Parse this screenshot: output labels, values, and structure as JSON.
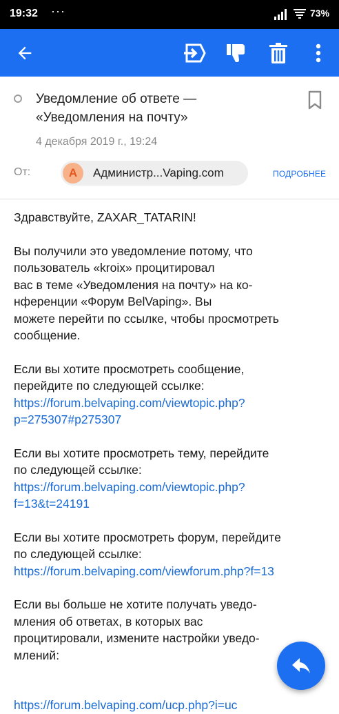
{
  "status_bar": {
    "time": "19:32",
    "dots": "···",
    "battery": "73%"
  },
  "app_bar": {
    "accent": "#1b6ff0",
    "icons": [
      "back-arrow-icon",
      "move-to-folder-icon",
      "spam-icon",
      "trash-icon",
      "more-vert-icon"
    ]
  },
  "message": {
    "subject_line1": "Уведомление об ответе —",
    "subject_line2": "«Уведомления на почту»",
    "date": "4 декабря 2019 г., 19:24",
    "from_label": "От:",
    "sender_initial": "A",
    "sender_name": "Администр...Vaping.com",
    "details_label": "ПОДРОБНЕЕ"
  },
  "body": {
    "greeting": "Здравствуйте, ZAXAR_TATARIN!",
    "p1_l1": "Вы получили это уведомление потому, что",
    "p1_l2": "пользователь «kroix» процитировал",
    "p1_l3": "вас в теме «Уведомления на почту» на ко-",
    "p1_l4": "нференции «Форум BelVaping». Вы",
    "p1_l5": "можете перейти по ссылке, чтобы просмотреть",
    "p1_l6": "сообщение.",
    "p2_l1": "Если вы хотите просмотреть сообщение,",
    "p2_l2": "перейдите по следующей ссылке:",
    "link1_l1": "https://forum.belvaping.com/viewtopic.php?",
    "link1_l2": "p=275307#p275307",
    "p3_l1": "Если вы хотите просмотреть тему, перейдите",
    "p3_l2": "по следующей ссылке:",
    "link2_l1": "https://forum.belvaping.com/viewtopic.php?",
    "link2_l2": "f=13&t=24191",
    "p4_l1": "Если вы хотите просмотреть форум, перейдите",
    "p4_l2": "по следующей ссылке:",
    "link3": "https://forum.belvaping.com/viewforum.php?f=13",
    "p5_l1": "Если вы больше не хотите получать уведо-",
    "p5_l2": "мления об ответах, в которых вас",
    "p5_l3": "процитировали, измените настройки уведо-",
    "p5_l4": "млений:",
    "link4": "https://forum.belvaping.com/ucp.php?i=uc"
  }
}
